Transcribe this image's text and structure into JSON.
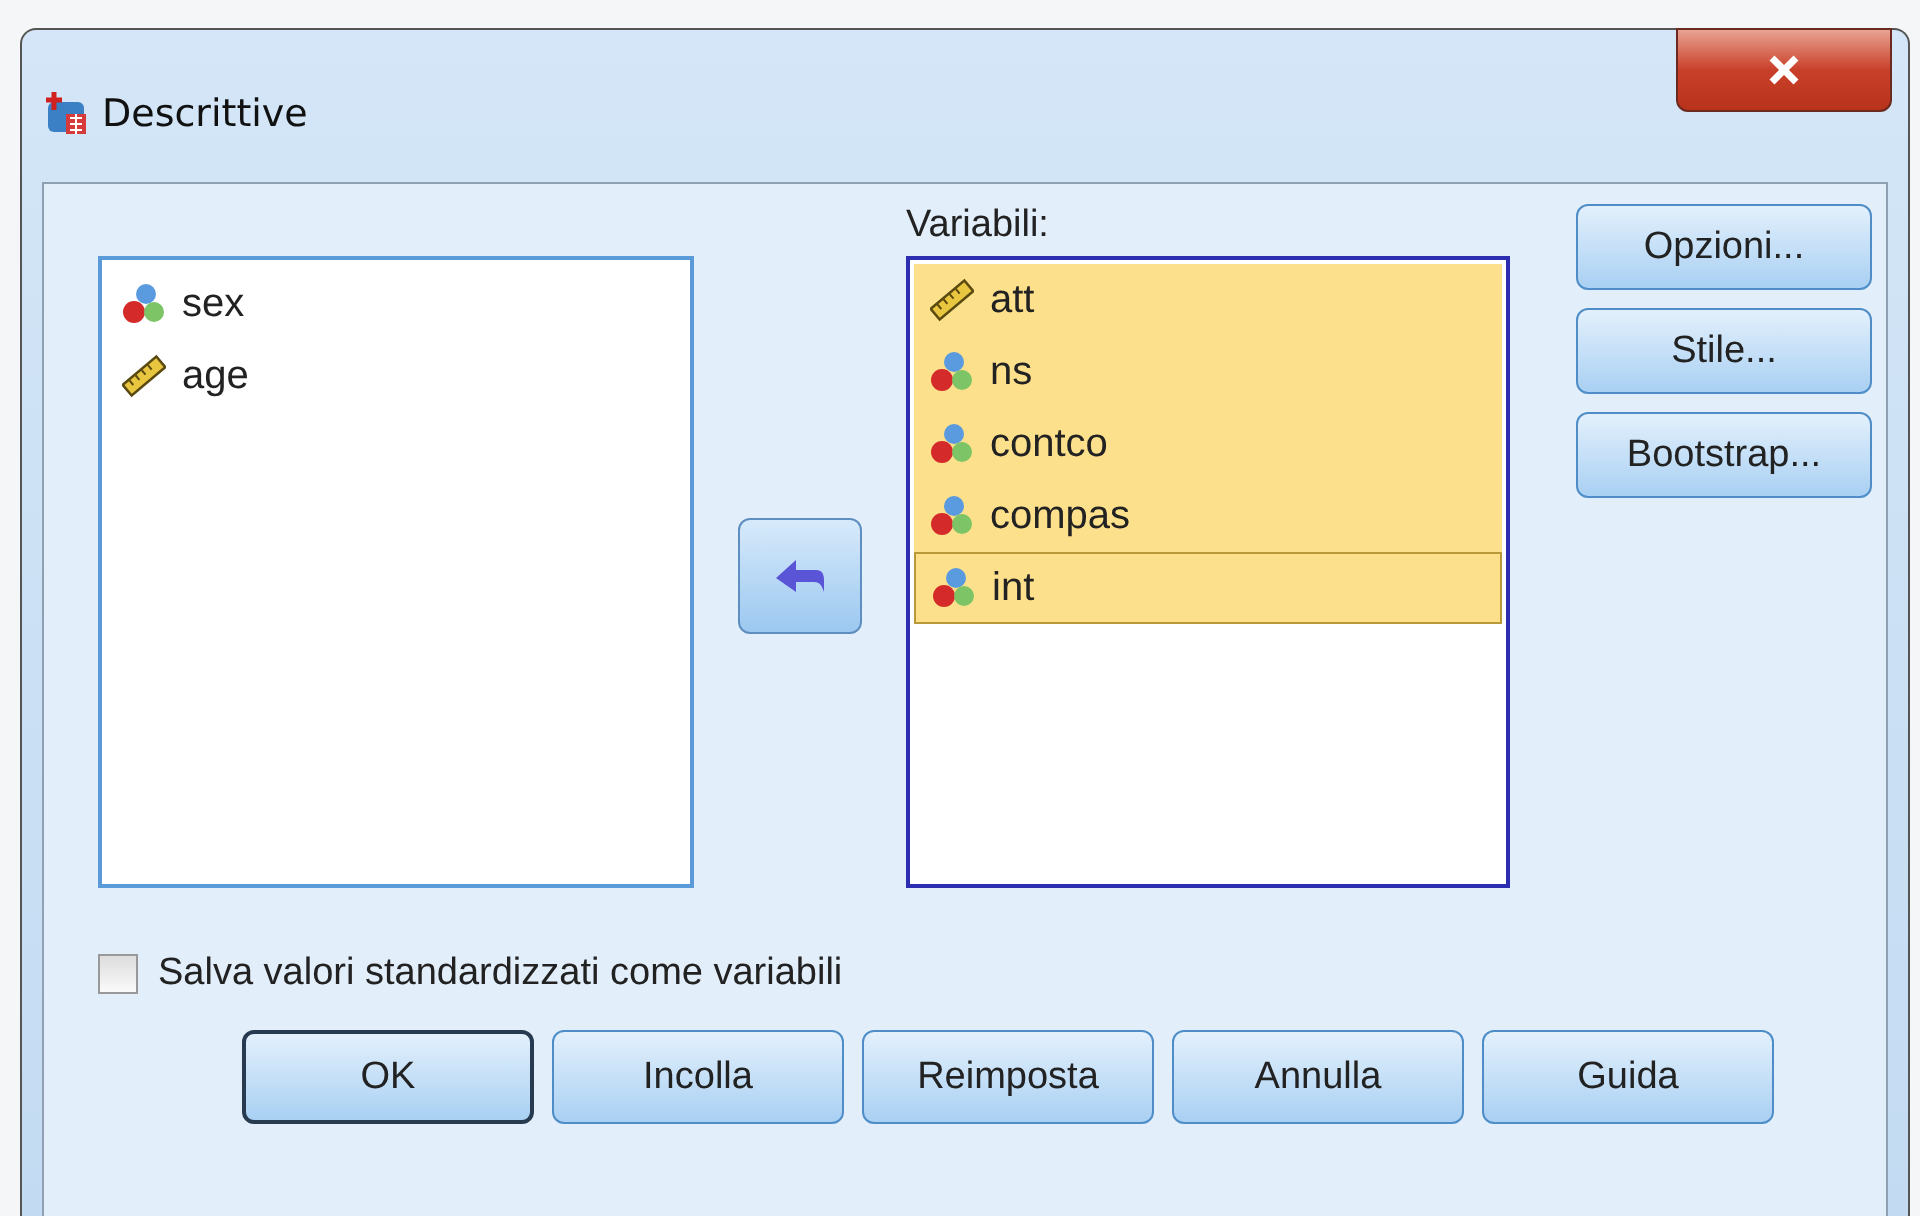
{
  "window": {
    "title": "Descrittive"
  },
  "source_list": {
    "items": [
      {
        "name": "sex",
        "kind": "nominal",
        "selected": false
      },
      {
        "name": "age",
        "kind": "scale",
        "selected": false
      }
    ]
  },
  "target_list": {
    "label": "Variabili:",
    "items": [
      {
        "name": "att",
        "kind": "scale",
        "selected": true,
        "focused": false
      },
      {
        "name": "ns",
        "kind": "nominal",
        "selected": true,
        "focused": false
      },
      {
        "name": "contco",
        "kind": "nominal",
        "selected": true,
        "focused": false
      },
      {
        "name": "compas",
        "kind": "nominal",
        "selected": true,
        "focused": false
      },
      {
        "name": "int",
        "kind": "nominal",
        "selected": true,
        "focused": true
      }
    ]
  },
  "side_buttons": [
    "Opzioni...",
    "Stile...",
    "Bootstrap..."
  ],
  "checkbox": {
    "label": "Salva valori standardizzati come variabili",
    "checked": false
  },
  "buttons": [
    {
      "label": "OK",
      "default": true
    },
    {
      "label": "Incolla",
      "default": false
    },
    {
      "label": "Reimposta",
      "default": false
    },
    {
      "label": "Annulla",
      "default": false
    },
    {
      "label": "Guida",
      "default": false
    }
  ]
}
